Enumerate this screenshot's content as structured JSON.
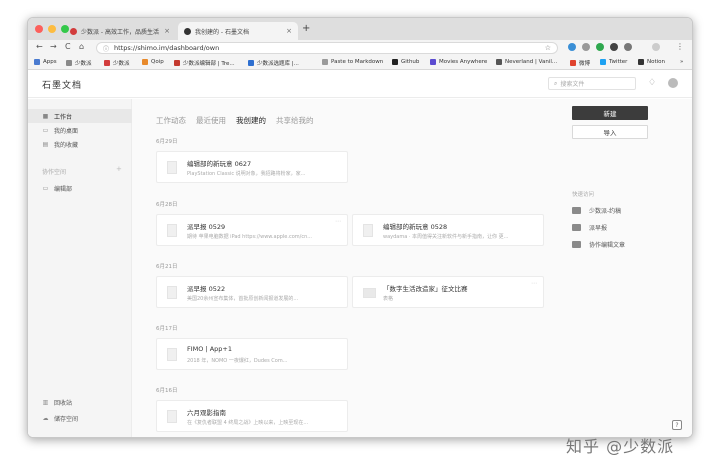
{
  "browser": {
    "tabs": [
      {
        "title": "少数派 - 高效工作，品质生活",
        "active": false
      },
      {
        "title": "我创建的 - 石墨文档",
        "active": true
      }
    ],
    "new_tab": "+",
    "url": "https://shimo.im/dashboard/own",
    "nav": {
      "back": "←",
      "forward": "→",
      "reload": "C",
      "home": "⌂",
      "info": "ⓘ",
      "star": "☆"
    },
    "bookmarks": [
      {
        "label": "Apps",
        "color": "#4a7bd0"
      },
      {
        "label": "少数派",
        "color": "#8a8a8a"
      },
      {
        "label": "少数派",
        "color": "#d23c3c"
      },
      {
        "label": "Qoip",
        "color": "#e88a2c"
      },
      {
        "label": "少数派编辑部 | Tre...",
        "color": "#c43a2f"
      },
      {
        "label": "少数派选题库 |...",
        "color": "#2e6fd0"
      },
      {
        "label": "Paste to Markdown",
        "color": "#9a9a9a"
      },
      {
        "label": "Github",
        "color": "#222222"
      },
      {
        "label": "Movies Anywhere",
        "color": "#5b4bd0"
      },
      {
        "label": "Neverland | Vanil...",
        "color": "#555555"
      },
      {
        "label": "微博",
        "color": "#e0432e"
      },
      {
        "label": "Twitter",
        "color": "#1da1f2"
      },
      {
        "label": "Notion",
        "color": "#333333"
      }
    ],
    "more": "»"
  },
  "app": {
    "logo": "石墨文档",
    "search_placeholder": "搜索文件",
    "search_icon": "⌕",
    "bell_icon": "♢"
  },
  "sidebar": {
    "items": [
      {
        "icon": "■",
        "label": "工作台",
        "active": true
      },
      {
        "icon": "▭",
        "label": "我的桌面",
        "active": false
      },
      {
        "icon": "▤",
        "label": "我的收藏",
        "active": false
      }
    ],
    "group": "协作空间",
    "group_add": "+",
    "group_items": [
      {
        "icon": "▭",
        "label": "编辑部"
      }
    ],
    "bottom": [
      {
        "icon": "▥",
        "label": "回收站"
      },
      {
        "icon": "☁",
        "label": "储存空间"
      }
    ]
  },
  "main": {
    "tabs": [
      "工作动态",
      "最近使用",
      "我创建的",
      "共享给我的"
    ],
    "active_tab": "我创建的",
    "groups": [
      {
        "date": "6月29日",
        "cards": [
          {
            "title": "编辑部的新玩意 0627",
            "sub": "PlayStation Classic 说明对象，我招路将粉家，家..."
          }
        ]
      },
      {
        "date": "6月28日",
        "cards": [
          {
            "title": "派早报 0529",
            "sub": "期待 苹果电脑数据 iPad https://www.apple.com/cn..."
          },
          {
            "title": "编辑部的新玩意 0528",
            "sub": "waydama · 本周值得关注新软件与新手指南，让你 更..."
          }
        ]
      },
      {
        "date": "6月21日",
        "cards": [
          {
            "title": "派早报 0522",
            "sub": "美国20余州宣布集体，首批原创新闻报道发展的..."
          },
          {
            "title": "「数字生活改造家」征文比赛",
            "sub": "表格"
          }
        ]
      },
      {
        "date": "6月17日",
        "cards": [
          {
            "title": "FIMO | App+1",
            "sub": "2018 年，NOMO 一夜爆红，Dudes Com..."
          }
        ]
      },
      {
        "date": "6月16日",
        "cards": [
          {
            "title": "六月观影指南",
            "sub": "在《复仇者联盟 4 终局之战》上映以来，上映至现在..."
          }
        ]
      }
    ],
    "more_icon": "⋯"
  },
  "right_panel": {
    "new_button": "新建",
    "import_button": "导入",
    "quick_access_title": "快速访问",
    "quick_access": [
      "少数派-约稿",
      "派早报",
      "协作编辑文章"
    ]
  },
  "help_icon": "?",
  "watermark": "知乎 @少数派"
}
